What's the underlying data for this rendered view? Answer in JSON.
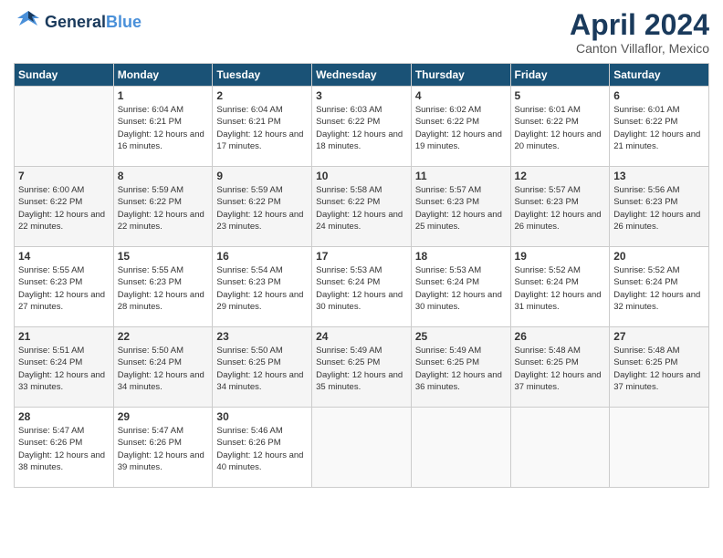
{
  "logo": {
    "text_general": "General",
    "text_blue": "Blue"
  },
  "title": {
    "month_year": "April 2024",
    "location": "Canton Villaflor, Mexico"
  },
  "days_of_week": [
    "Sunday",
    "Monday",
    "Tuesday",
    "Wednesday",
    "Thursday",
    "Friday",
    "Saturday"
  ],
  "weeks": [
    [
      {
        "day": "",
        "sunrise": "",
        "sunset": "",
        "daylight": ""
      },
      {
        "day": "1",
        "sunrise": "Sunrise: 6:04 AM",
        "sunset": "Sunset: 6:21 PM",
        "daylight": "Daylight: 12 hours and 16 minutes."
      },
      {
        "day": "2",
        "sunrise": "Sunrise: 6:04 AM",
        "sunset": "Sunset: 6:21 PM",
        "daylight": "Daylight: 12 hours and 17 minutes."
      },
      {
        "day": "3",
        "sunrise": "Sunrise: 6:03 AM",
        "sunset": "Sunset: 6:22 PM",
        "daylight": "Daylight: 12 hours and 18 minutes."
      },
      {
        "day": "4",
        "sunrise": "Sunrise: 6:02 AM",
        "sunset": "Sunset: 6:22 PM",
        "daylight": "Daylight: 12 hours and 19 minutes."
      },
      {
        "day": "5",
        "sunrise": "Sunrise: 6:01 AM",
        "sunset": "Sunset: 6:22 PM",
        "daylight": "Daylight: 12 hours and 20 minutes."
      },
      {
        "day": "6",
        "sunrise": "Sunrise: 6:01 AM",
        "sunset": "Sunset: 6:22 PM",
        "daylight": "Daylight: 12 hours and 21 minutes."
      }
    ],
    [
      {
        "day": "7",
        "sunrise": "Sunrise: 6:00 AM",
        "sunset": "Sunset: 6:22 PM",
        "daylight": "Daylight: 12 hours and 22 minutes."
      },
      {
        "day": "8",
        "sunrise": "Sunrise: 5:59 AM",
        "sunset": "Sunset: 6:22 PM",
        "daylight": "Daylight: 12 hours and 22 minutes."
      },
      {
        "day": "9",
        "sunrise": "Sunrise: 5:59 AM",
        "sunset": "Sunset: 6:22 PM",
        "daylight": "Daylight: 12 hours and 23 minutes."
      },
      {
        "day": "10",
        "sunrise": "Sunrise: 5:58 AM",
        "sunset": "Sunset: 6:22 PM",
        "daylight": "Daylight: 12 hours and 24 minutes."
      },
      {
        "day": "11",
        "sunrise": "Sunrise: 5:57 AM",
        "sunset": "Sunset: 6:23 PM",
        "daylight": "Daylight: 12 hours and 25 minutes."
      },
      {
        "day": "12",
        "sunrise": "Sunrise: 5:57 AM",
        "sunset": "Sunset: 6:23 PM",
        "daylight": "Daylight: 12 hours and 26 minutes."
      },
      {
        "day": "13",
        "sunrise": "Sunrise: 5:56 AM",
        "sunset": "Sunset: 6:23 PM",
        "daylight": "Daylight: 12 hours and 26 minutes."
      }
    ],
    [
      {
        "day": "14",
        "sunrise": "Sunrise: 5:55 AM",
        "sunset": "Sunset: 6:23 PM",
        "daylight": "Daylight: 12 hours and 27 minutes."
      },
      {
        "day": "15",
        "sunrise": "Sunrise: 5:55 AM",
        "sunset": "Sunset: 6:23 PM",
        "daylight": "Daylight: 12 hours and 28 minutes."
      },
      {
        "day": "16",
        "sunrise": "Sunrise: 5:54 AM",
        "sunset": "Sunset: 6:23 PM",
        "daylight": "Daylight: 12 hours and 29 minutes."
      },
      {
        "day": "17",
        "sunrise": "Sunrise: 5:53 AM",
        "sunset": "Sunset: 6:24 PM",
        "daylight": "Daylight: 12 hours and 30 minutes."
      },
      {
        "day": "18",
        "sunrise": "Sunrise: 5:53 AM",
        "sunset": "Sunset: 6:24 PM",
        "daylight": "Daylight: 12 hours and 30 minutes."
      },
      {
        "day": "19",
        "sunrise": "Sunrise: 5:52 AM",
        "sunset": "Sunset: 6:24 PM",
        "daylight": "Daylight: 12 hours and 31 minutes."
      },
      {
        "day": "20",
        "sunrise": "Sunrise: 5:52 AM",
        "sunset": "Sunset: 6:24 PM",
        "daylight": "Daylight: 12 hours and 32 minutes."
      }
    ],
    [
      {
        "day": "21",
        "sunrise": "Sunrise: 5:51 AM",
        "sunset": "Sunset: 6:24 PM",
        "daylight": "Daylight: 12 hours and 33 minutes."
      },
      {
        "day": "22",
        "sunrise": "Sunrise: 5:50 AM",
        "sunset": "Sunset: 6:24 PM",
        "daylight": "Daylight: 12 hours and 34 minutes."
      },
      {
        "day": "23",
        "sunrise": "Sunrise: 5:50 AM",
        "sunset": "Sunset: 6:25 PM",
        "daylight": "Daylight: 12 hours and 34 minutes."
      },
      {
        "day": "24",
        "sunrise": "Sunrise: 5:49 AM",
        "sunset": "Sunset: 6:25 PM",
        "daylight": "Daylight: 12 hours and 35 minutes."
      },
      {
        "day": "25",
        "sunrise": "Sunrise: 5:49 AM",
        "sunset": "Sunset: 6:25 PM",
        "daylight": "Daylight: 12 hours and 36 minutes."
      },
      {
        "day": "26",
        "sunrise": "Sunrise: 5:48 AM",
        "sunset": "Sunset: 6:25 PM",
        "daylight": "Daylight: 12 hours and 37 minutes."
      },
      {
        "day": "27",
        "sunrise": "Sunrise: 5:48 AM",
        "sunset": "Sunset: 6:25 PM",
        "daylight": "Daylight: 12 hours and 37 minutes."
      }
    ],
    [
      {
        "day": "28",
        "sunrise": "Sunrise: 5:47 AM",
        "sunset": "Sunset: 6:26 PM",
        "daylight": "Daylight: 12 hours and 38 minutes."
      },
      {
        "day": "29",
        "sunrise": "Sunrise: 5:47 AM",
        "sunset": "Sunset: 6:26 PM",
        "daylight": "Daylight: 12 hours and 39 minutes."
      },
      {
        "day": "30",
        "sunrise": "Sunrise: 5:46 AM",
        "sunset": "Sunset: 6:26 PM",
        "daylight": "Daylight: 12 hours and 40 minutes."
      },
      {
        "day": "",
        "sunrise": "",
        "sunset": "",
        "daylight": ""
      },
      {
        "day": "",
        "sunrise": "",
        "sunset": "",
        "daylight": ""
      },
      {
        "day": "",
        "sunrise": "",
        "sunset": "",
        "daylight": ""
      },
      {
        "day": "",
        "sunrise": "",
        "sunset": "",
        "daylight": ""
      }
    ]
  ]
}
